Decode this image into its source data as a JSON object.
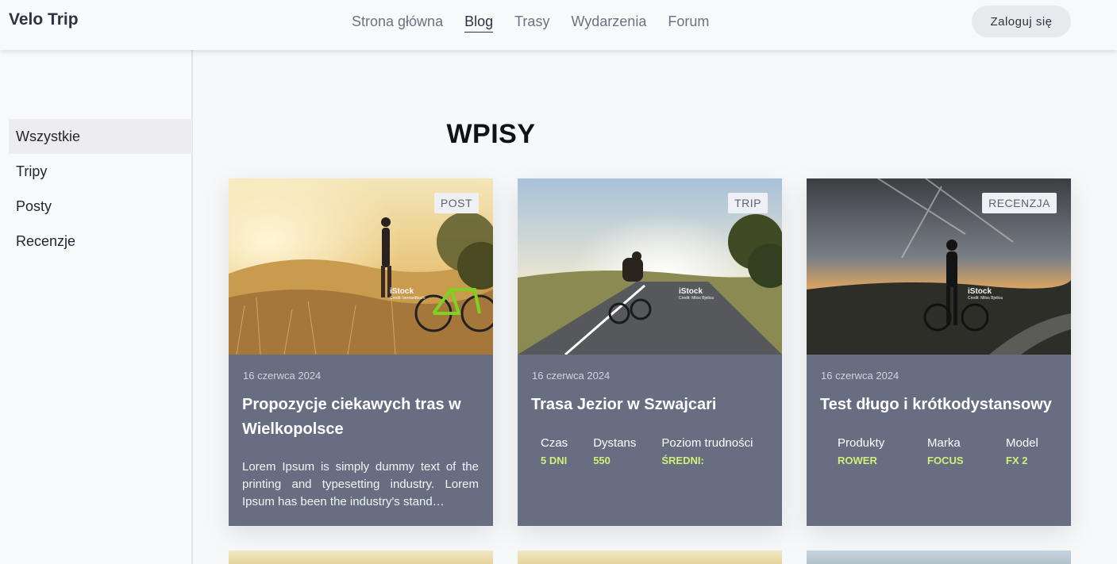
{
  "header": {
    "brand": "Velo Trip",
    "nav": [
      {
        "label": "Strona główna",
        "active": false
      },
      {
        "label": "Blog",
        "active": true
      },
      {
        "label": "Trasy",
        "active": false
      },
      {
        "label": "Wydarzenia",
        "active": false
      },
      {
        "label": "Forum",
        "active": false
      }
    ],
    "login_label": "Zaloguj się"
  },
  "sidebar": {
    "items": [
      {
        "label": "Wszystkie",
        "active": true
      },
      {
        "label": "Tripy",
        "active": false
      },
      {
        "label": "Posty",
        "active": false
      },
      {
        "label": "Recenzje",
        "active": false
      }
    ]
  },
  "main": {
    "title": "WPISY",
    "cards": [
      {
        "badge": "POST",
        "date": "16 czerwca 2024",
        "title": "Propozycje ciekawych tras w Wielkopolsce",
        "excerpt": "Lorem Ipsum is simply dummy text of the printing and typesetting industry. Lorem Ipsum has been the industry's stand…",
        "watermark": {
          "brand": "iStock",
          "credit": "Credit: bernardbodo"
        }
      },
      {
        "badge": "TRIP",
        "date": "16 czerwca 2024",
        "title": "Trasa Jezior w Szwajcari",
        "specs": [
          {
            "label": "Czas",
            "value": "5 DNI"
          },
          {
            "label": "Dystans",
            "value": "550"
          },
          {
            "label": "Poziom trudności",
            "value": "ŚREDNI:"
          }
        ],
        "watermark": {
          "brand": "iStock",
          "credit": "Credit: Milos Bjelica"
        }
      },
      {
        "badge": "RECENZJA",
        "date": "16 czerwca 2024",
        "title": "Test długo i krótkodystansowy",
        "specs": [
          {
            "label": "Produkty",
            "value": "ROWER"
          },
          {
            "label": "Marka",
            "value": "FOCUS"
          },
          {
            "label": "Model",
            "value": "FX 2"
          }
        ],
        "watermark": {
          "brand": "iStock",
          "credit": "Credit: Milos Bjelica"
        }
      }
    ]
  },
  "colors": {
    "card_bg": "#676e82",
    "accent_value": "#cff07a",
    "badge_bg": "#eef0f4",
    "sidebar_active": "#ededef"
  }
}
